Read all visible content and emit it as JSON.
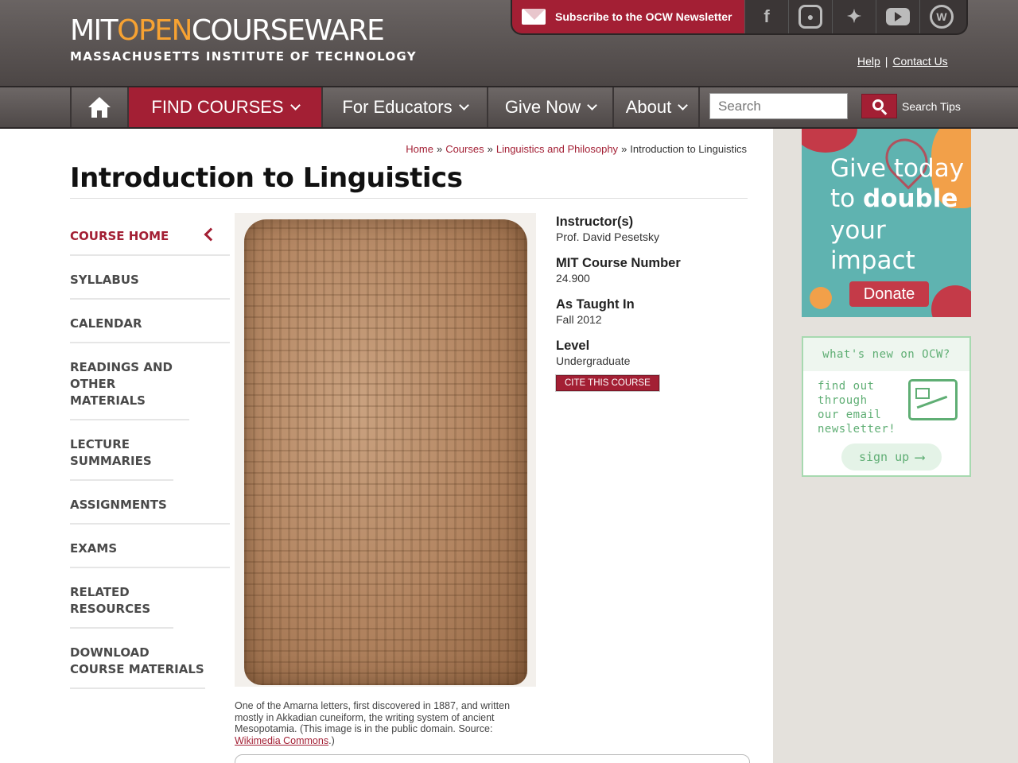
{
  "header": {
    "logo_mit": "MIT",
    "logo_open": "OPEN",
    "logo_courseware": "COURSEWARE",
    "logo_sub": "MASSACHUSETTS INSTITUTE OF TECHNOLOGY",
    "subscribe_label": "Subscribe to the OCW Newsletter",
    "help_label": "Help",
    "contact_label": "Contact Us",
    "social": [
      "facebook",
      "instagram",
      "twitter",
      "youtube",
      "wordpress"
    ]
  },
  "nav": {
    "find_courses": "FIND COURSES",
    "for_educators": "For Educators",
    "give_now": "Give Now",
    "about": "About",
    "search_placeholder": "Search",
    "search_tips": "Search Tips"
  },
  "breadcrumb": {
    "home": "Home",
    "courses": "Courses",
    "dept": "Linguistics and Philosophy",
    "current": "Introduction to Linguistics",
    "separator": "»"
  },
  "page_title": "Introduction to Linguistics",
  "sidenav": [
    "COURSE HOME",
    "SYLLABUS",
    "CALENDAR",
    "READINGS AND OTHER MATERIALS",
    "LECTURE SUMMARIES",
    "ASSIGNMENTS",
    "EXAMS",
    "RELATED RESOURCES",
    "DOWNLOAD COURSE MATERIALS"
  ],
  "course_info": {
    "instructor_label": "Instructor(s)",
    "instructor_value": "Prof. David Pesetsky",
    "number_label": "MIT Course Number",
    "number_value": "24.900",
    "taught_label": "As Taught In",
    "taught_value": "Fall 2012",
    "level_label": "Level",
    "level_value": "Undergraduate",
    "cite_label": "CITE THIS COURSE"
  },
  "caption": {
    "text": "One of the Amarna letters, first discovered in 1887, and written mostly in Akkadian cuneiform, the writing system of ancient Mesopotamia. (This image is in the public domain. Source: ",
    "link": "Wikimedia Commons",
    "end": ".)"
  },
  "ad": {
    "line1": "Give today",
    "line2a": "to ",
    "line2b": "double",
    "line3": "your",
    "line4": "impact",
    "donate": "Donate"
  },
  "newsletter": {
    "title": "what's new on OCW?",
    "line1": "find out",
    "line2": "through",
    "line3": "our email",
    "line4": "newsletter!",
    "signup": "sign up",
    "arrow": "⟶"
  },
  "colors": {
    "brand_red": "#a31f34",
    "brand_orange": "#f7a232",
    "header_gray": "#5a5453"
  }
}
